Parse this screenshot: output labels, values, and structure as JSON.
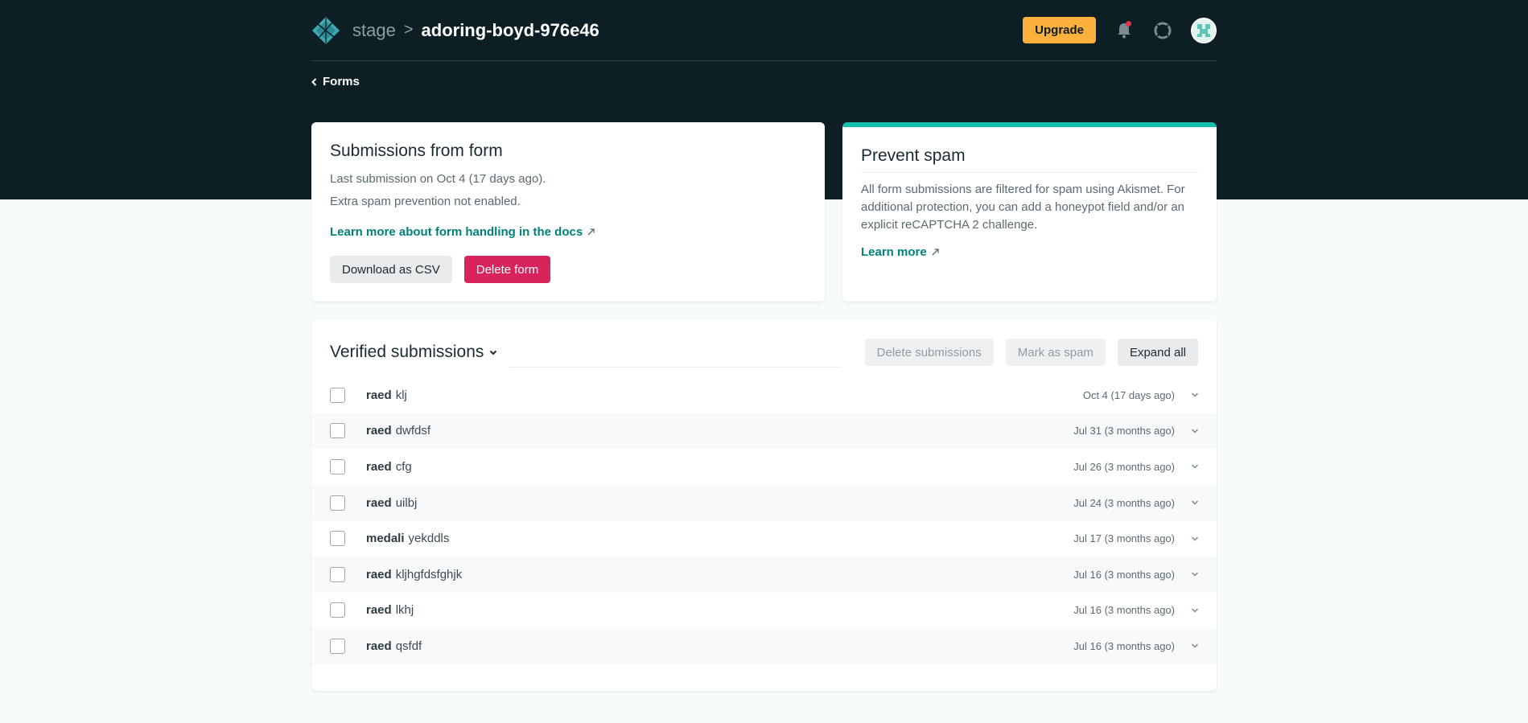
{
  "header": {
    "team": "stage",
    "separator": ">",
    "site": "adoring-boyd-976e46",
    "upgrade_label": "Upgrade",
    "icons": [
      "netlify-logo-icon",
      "bell-icon",
      "support-icon",
      "avatar"
    ]
  },
  "back_link": {
    "label": "Forms"
  },
  "form_card": {
    "title": "Submissions from form",
    "last_submission": "Last submission on Oct 4 (17 days ago).",
    "spam_status": "Extra spam prevention not enabled.",
    "docs_link": "Learn more about form handling in the docs",
    "download_label": "Download as CSV",
    "delete_label": "Delete form"
  },
  "spam_card": {
    "title": "Prevent spam",
    "text": "All form submissions are filtered for spam using Akismet. For additional protection, you can add a honeypot field and/or an explicit reCAPTCHA 2 challenge.",
    "learn_more": "Learn more",
    "accent_color": "#15bfab"
  },
  "submissions": {
    "title": "Verified submissions",
    "delete_label": "Delete submissions",
    "spam_label": "Mark as spam",
    "expand_label": "Expand all",
    "rows": [
      {
        "name": "raed",
        "message": "klj",
        "date": "Oct 4 (17 days ago)"
      },
      {
        "name": "raed",
        "message": "dwfdsf",
        "date": "Jul 31 (3 months ago)"
      },
      {
        "name": "raed",
        "message": "cfg",
        "date": "Jul 26 (3 months ago)"
      },
      {
        "name": "raed",
        "message": "uilbj",
        "date": "Jul 24 (3 months ago)"
      },
      {
        "name": "medali",
        "message": "yekddls",
        "date": "Jul 17 (3 months ago)"
      },
      {
        "name": "raed",
        "message": "kljhgfdsfghjk",
        "date": "Jul 16 (3 months ago)"
      },
      {
        "name": "raed",
        "message": "lkhj",
        "date": "Jul 16 (3 months ago)"
      },
      {
        "name": "raed",
        "message": "qsfdf",
        "date": "Jul 16 (3 months ago)"
      }
    ]
  },
  "colors": {
    "header_bg": "#0e1e25",
    "page_bg": "#f6fcfb",
    "upgrade": "#fbb13c",
    "danger": "#d8245a",
    "link": "#00827a"
  }
}
